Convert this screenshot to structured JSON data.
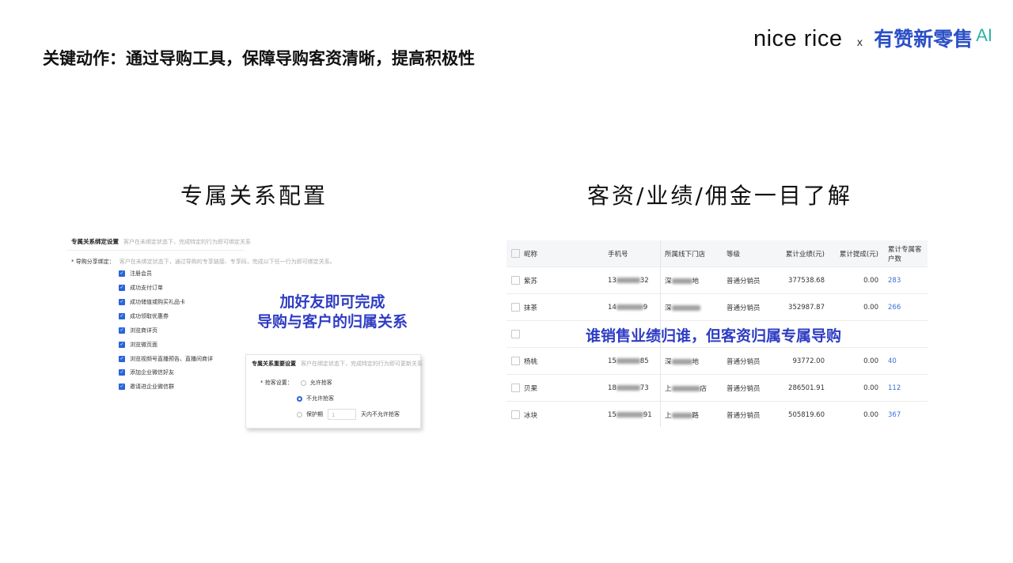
{
  "slide_title": "关键动作：通过导购工具，保障导购客资清晰，提高积极性",
  "brand": {
    "nice_rice": "nice rice",
    "x": "x",
    "youzan": "有赞新零售",
    "ai": "AI"
  },
  "left_section": {
    "title": "专属关系配置",
    "screenshot": {
      "header": "专属关系绑定设置",
      "header_hint": "客户在未绑定状态下，完成特定的行为即可绑定关系",
      "label": "* 导购分享绑定：",
      "label_hint": "客户在未绑定状态下，通过导购的专享链接、专享码，完成以下任一行为即可绑定关系。",
      "options": [
        "注册会员",
        "成功支付订单",
        "成功储值或购买礼品卡",
        "成功领取优惠券",
        "浏览商详页",
        "浏览微页面",
        "浏览视频号直播预告、直播间商详",
        "添加企业微信好友",
        "邀请进企业微信群"
      ],
      "inset": {
        "header": "专属关系重要设置",
        "header_hint": "客户在绑定状态下，完成特定的行为即可更新关系",
        "label": "* 抢客设置：",
        "radio_allow": "允许抢客",
        "radio_deny": "不允许抢客",
        "protect_label": "保护期",
        "protect_value": "1",
        "protect_suffix": "天内不允许抢客"
      }
    },
    "overlay_line1": "加好友即可完成",
    "overlay_line2": "导购与客户的归属关系"
  },
  "right_section": {
    "title": "客资/业绩/佣金一目了解",
    "table": {
      "headers": [
        "昵称",
        "手机号",
        "所属线下门店",
        "等级",
        "累计业绩(元)",
        "累计提成(元)",
        "累计专属客户数"
      ],
      "rows": [
        {
          "name": "紫苏",
          "phone_a": "13",
          "phone_b": "32",
          "store_a": "深",
          "store_b": "地",
          "level": "普通分销员",
          "perf": "377538.68",
          "comm": "0.00",
          "count": "283"
        },
        {
          "name": "抹茶",
          "phone_a": "14",
          "phone_b": "9",
          "store_a": "深",
          "store_b": "",
          "level": "普通分销员",
          "perf": "352987.87",
          "comm": "0.00",
          "count": "266"
        },
        {
          "name": "",
          "phone_a": "",
          "phone_b": "",
          "store_a": "",
          "store_b": "",
          "level": "",
          "perf": "",
          "comm": "",
          "count": ""
        },
        {
          "name": "杨桃",
          "phone_a": "15",
          "phone_b": "85",
          "store_a": "深",
          "store_b": "地",
          "level": "普通分销员",
          "perf": "93772.00",
          "comm": "0.00",
          "count": "40"
        },
        {
          "name": "贝果",
          "phone_a": "18",
          "phone_b": "73",
          "store_a": "上",
          "store_b": "店",
          "level": "普通分销员",
          "perf": "286501.91",
          "comm": "0.00",
          "count": "112"
        },
        {
          "name": "冰块",
          "phone_a": "15",
          "phone_b": "91",
          "store_a": "上",
          "store_b": "路",
          "level": "普通分销员",
          "perf": "505819.60",
          "comm": "0.00",
          "count": "367"
        }
      ]
    },
    "overlay": "谁销售业绩归谁，但客资归属专属导购"
  }
}
